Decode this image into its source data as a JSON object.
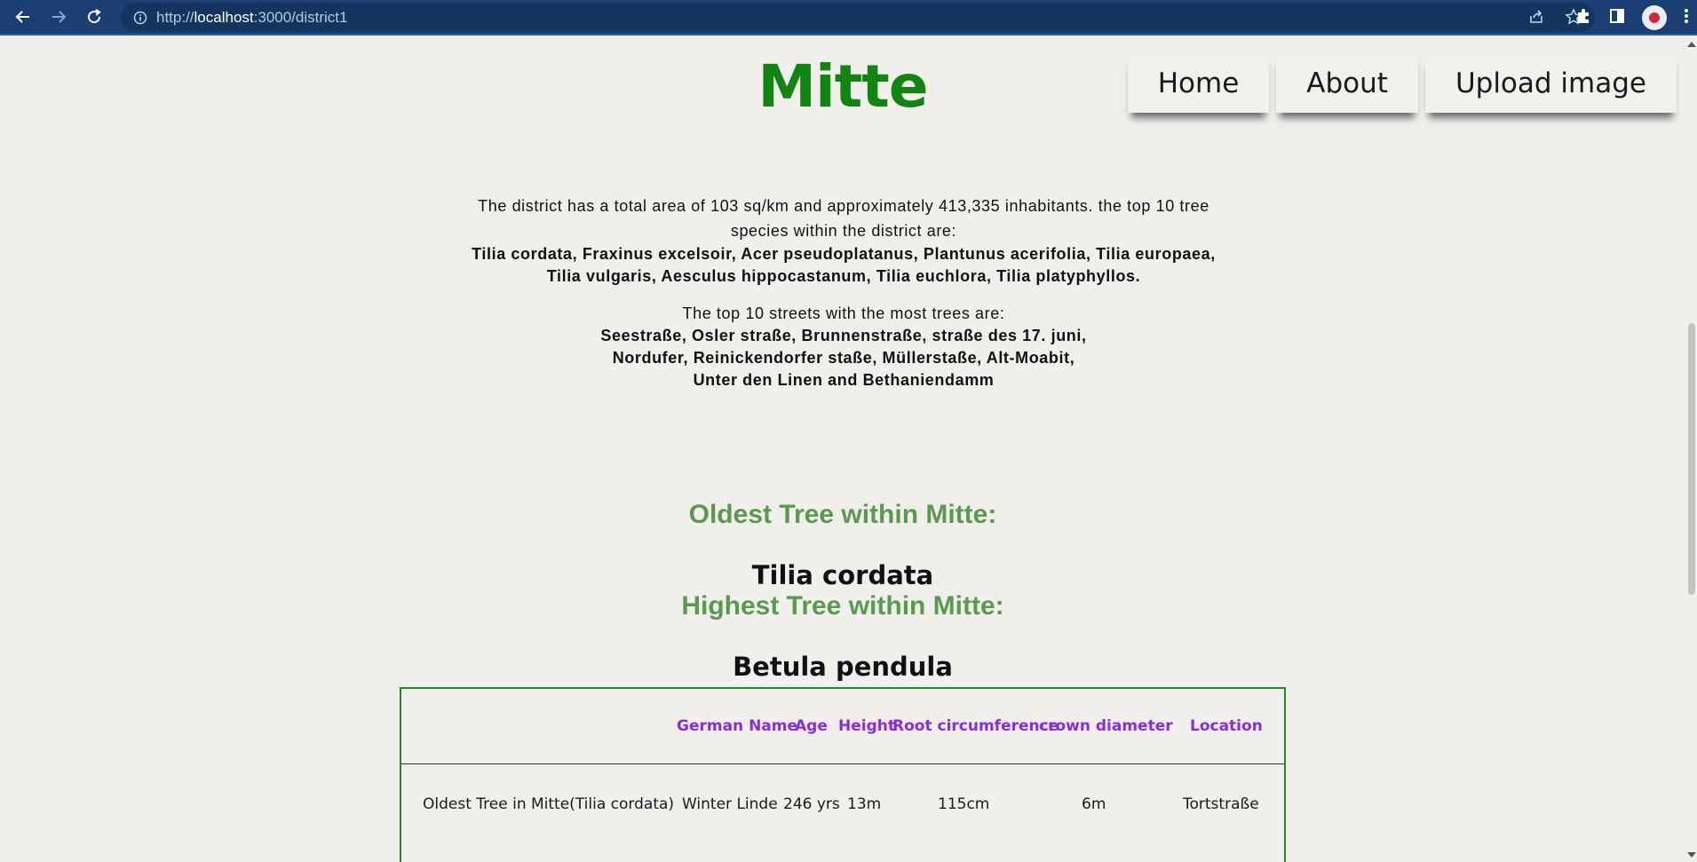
{
  "browser": {
    "url_prefix": "http://",
    "url_host": "localhost",
    "url_path": ":3000/district1"
  },
  "page": {
    "title": "Mitte",
    "nav": {
      "home": "Home",
      "about": "About",
      "upload": "Upload image"
    },
    "intro": {
      "text": "The district has a total area of 103 sq/km and approximately 413,335 inhabitants. the top 10 tree species within the district are:",
      "species": "Tilia cordata, Fraxinus excelsoir, Acer pseudoplatanus, Plantunus acerifolia, Tilia europaea, Tilia vulgaris, Aesculus hippocastanum, Tilia euchlora, Tilia platyphyllos."
    },
    "streets": {
      "heading": "The top 10 streets with the most trees are:",
      "line1": "Seestraße, Osler straße, Brunnenstraße, straße des 17. juni,",
      "line2": "Nordufer, Reinickendorfer staße, Müllerstaße, Alt-Moabit,",
      "line3": "Unter den Linen and Bethaniendamm"
    },
    "oldest": {
      "heading": "Oldest Tree within Mitte:",
      "species": "Tilia cordata"
    },
    "highest": {
      "heading": "Highest Tree within Mitte:",
      "species": "Betula pendula"
    },
    "table": {
      "headers": {
        "german_name": "German Name",
        "age": "Age",
        "height": "Height",
        "root": "Root circumference",
        "crown": "crown diameter",
        "location": "Location"
      },
      "row1": {
        "label": "Oldest Tree in Mitte(Tilia cordata)",
        "german_name": "Winter Linde",
        "age": "246 yrs",
        "height": "13m",
        "root": "115cm",
        "crown": "6m",
        "location": "Tortstraße"
      }
    }
  }
}
